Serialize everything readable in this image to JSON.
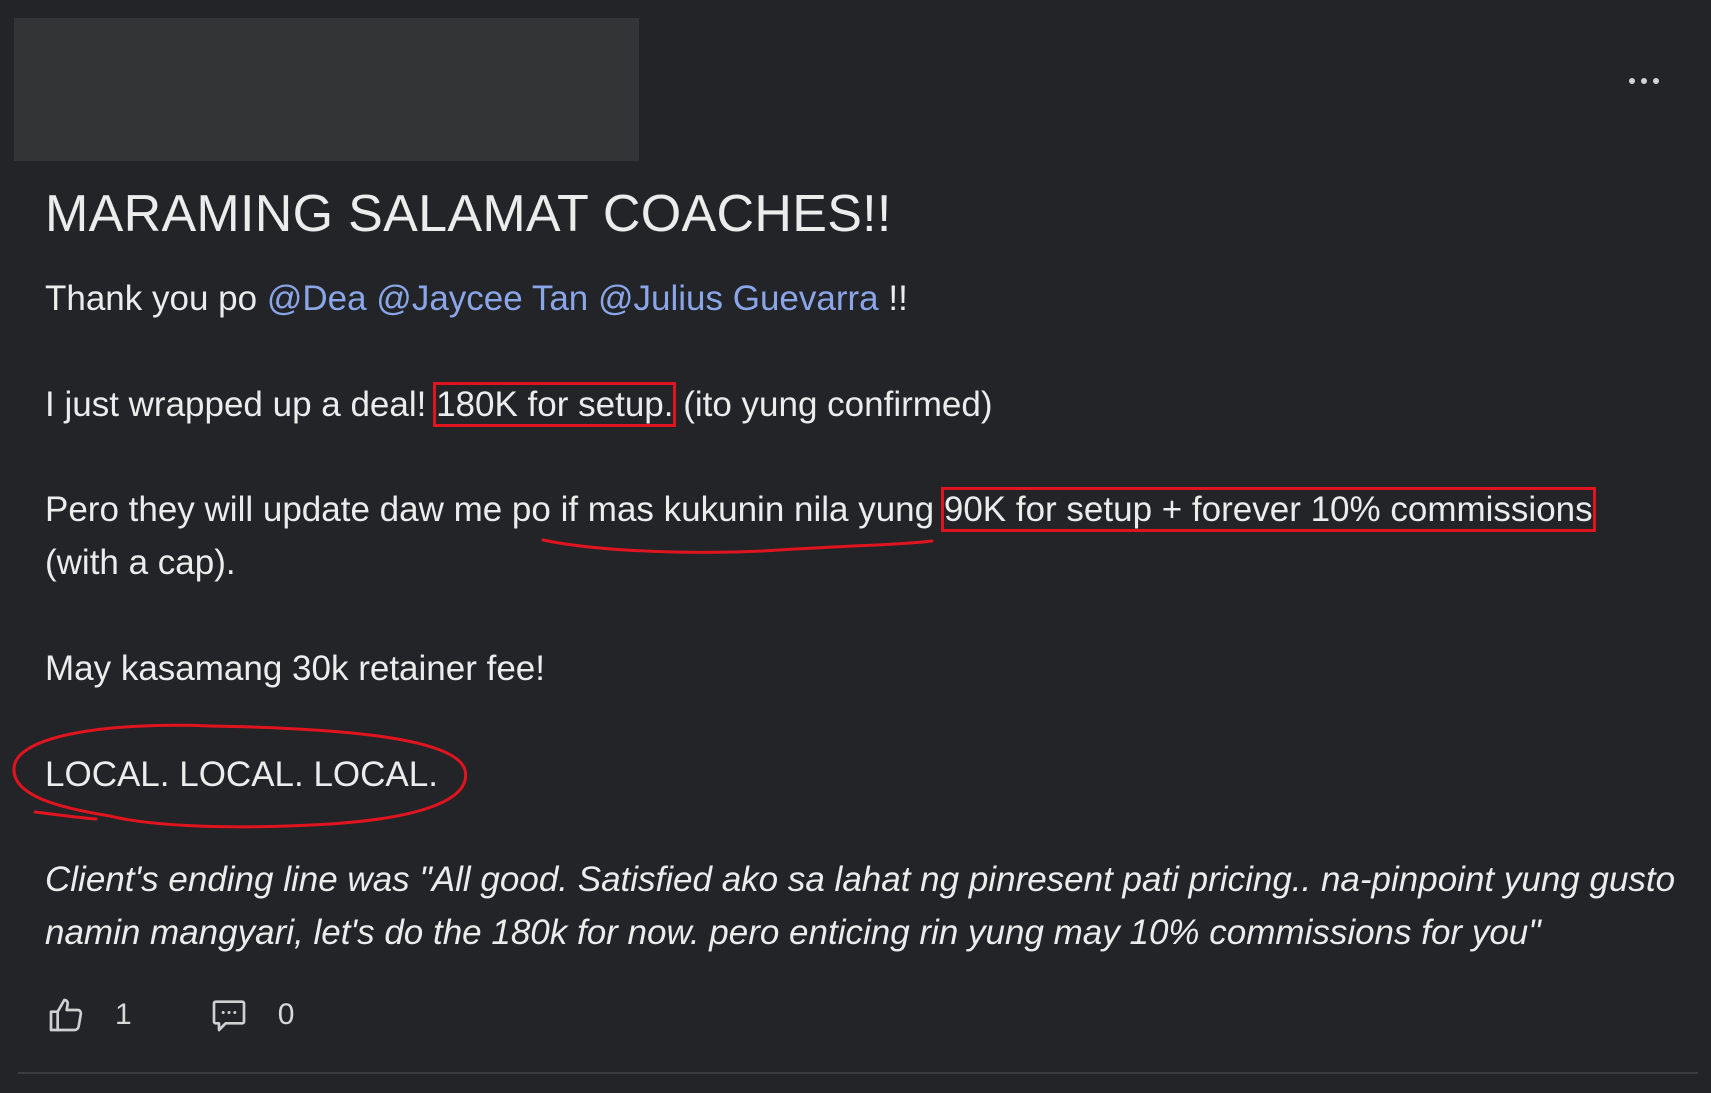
{
  "post": {
    "title": "MARAMING SALAMAT COACHES!!",
    "thanks": {
      "prefix": "Thank you po ",
      "mentions": [
        "@Dea",
        "@Jaycee Tan",
        "@Julius Guevarra"
      ],
      "suffix": " !!"
    },
    "deal_line": {
      "prefix": "I just wrapped up a deal! ",
      "highlight": "180K for setup.",
      "suffix": " (ito yung confirmed)"
    },
    "update_line": {
      "part1": "Pero they will update daw me po ",
      "underlined": "if mas kukunin nila yung",
      "space": " ",
      "highlight": "90K for setup + forever 10% commissions",
      "continuation": "(with a cap)."
    },
    "retainer_line": "May kasamang 30k retainer fee!",
    "local_line": "LOCAL. LOCAL. LOCAL.",
    "client_quote": {
      "line1": "Client's ending line was \"All good. Satisfied ako sa lahat ng pinresent pati pricing.. na-pinpoint yung gusto",
      "line2": "namin mangyari, let's do the 180k for now. pero enticing rin yung may 10% commissions for you\""
    }
  },
  "actions": {
    "like_count": "1",
    "comment_count": "0",
    "like_icon": "thumbs-up-icon",
    "comment_icon": "comment-icon",
    "more_icon": "more-horizontal-icon"
  },
  "colors": {
    "background": "#222428",
    "text": "#ececec",
    "mention": "#8aa6e8",
    "annotation_red": "#e0141e",
    "redacted_block": "#333436"
  }
}
